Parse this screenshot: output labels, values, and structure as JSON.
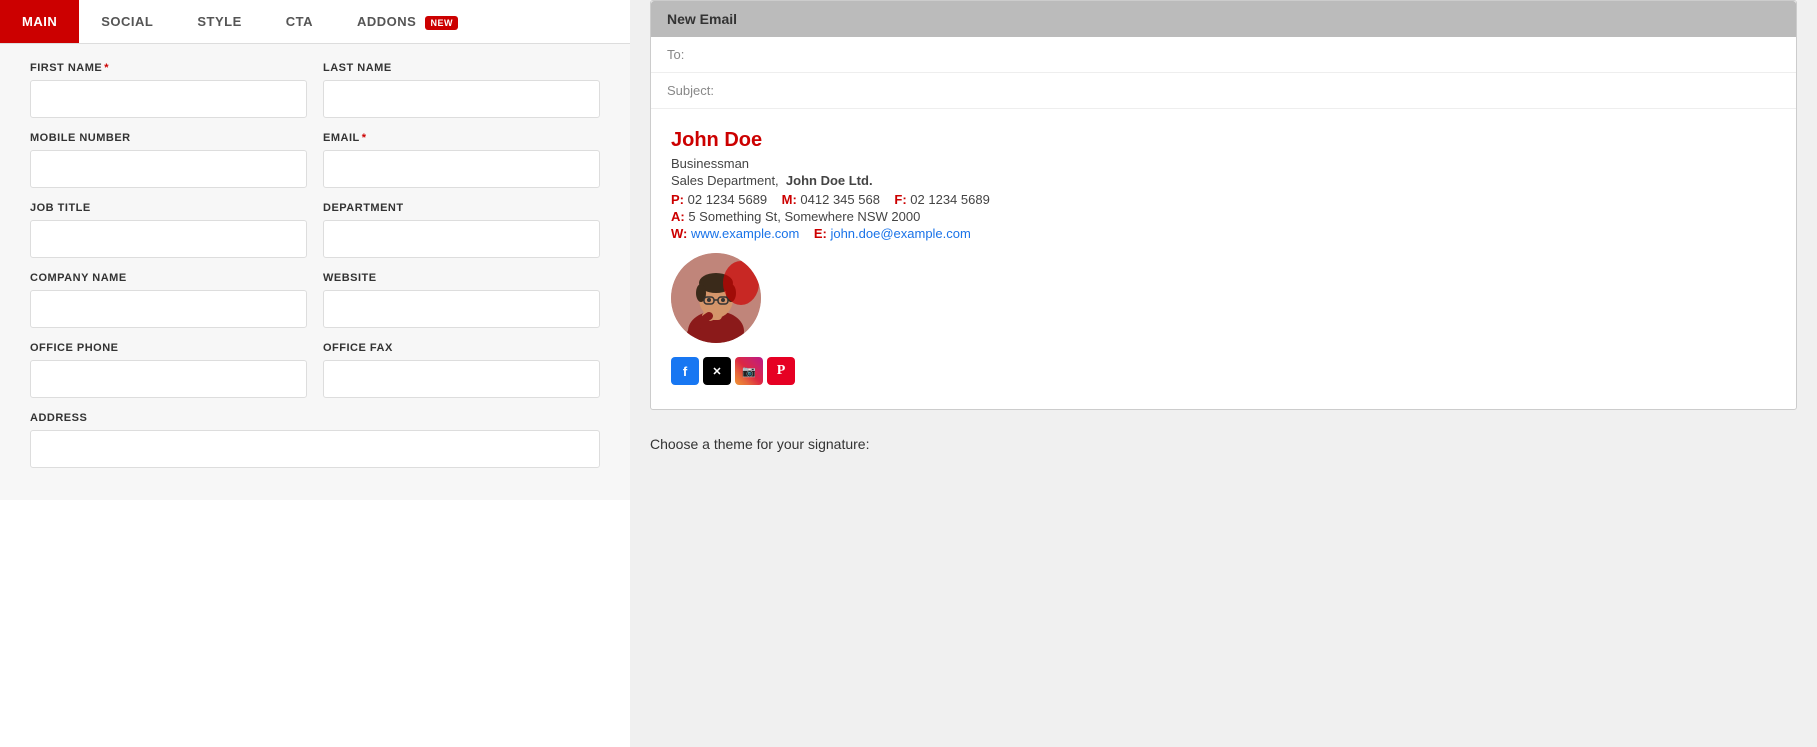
{
  "tabs": [
    {
      "id": "main",
      "label": "MAIN",
      "active": true,
      "badge": null
    },
    {
      "id": "social",
      "label": "SOCIAL",
      "active": false,
      "badge": null
    },
    {
      "id": "style",
      "label": "STYLE",
      "active": false,
      "badge": null
    },
    {
      "id": "cta",
      "label": "CTA",
      "active": false,
      "badge": null
    },
    {
      "id": "addons",
      "label": "ADDONS",
      "active": false,
      "badge": "NEW"
    }
  ],
  "form": {
    "fields": [
      {
        "id": "first-name",
        "label": "FIRST NAME",
        "required": true,
        "value": "",
        "placeholder": ""
      },
      {
        "id": "last-name",
        "label": "LAST NAME",
        "required": false,
        "value": "",
        "placeholder": ""
      },
      {
        "id": "mobile-number",
        "label": "MOBILE NUMBER",
        "required": false,
        "value": "",
        "placeholder": ""
      },
      {
        "id": "email",
        "label": "EMAIL",
        "required": true,
        "value": "",
        "placeholder": ""
      },
      {
        "id": "job-title",
        "label": "JOB TITLE",
        "required": false,
        "value": "",
        "placeholder": ""
      },
      {
        "id": "department",
        "label": "DEPARTMENT",
        "required": false,
        "value": "",
        "placeholder": ""
      },
      {
        "id": "company-name",
        "label": "COMPANY NAME",
        "required": false,
        "value": "",
        "placeholder": ""
      },
      {
        "id": "website",
        "label": "WEBSITE",
        "required": false,
        "value": "",
        "placeholder": ""
      },
      {
        "id": "office-phone",
        "label": "OFFICE PHONE",
        "required": false,
        "value": "",
        "placeholder": ""
      },
      {
        "id": "office-fax",
        "label": "OFFICE FAX",
        "required": false,
        "value": "",
        "placeholder": ""
      }
    ],
    "address": {
      "id": "address",
      "label": "ADDRESS",
      "required": false,
      "value": "",
      "placeholder": ""
    }
  },
  "email_preview": {
    "title": "New Email",
    "to_label": "To:",
    "subject_label": "Subject:"
  },
  "signature": {
    "name": "John Doe",
    "title": "Businessman",
    "dept_prefix": "Sales Department,",
    "company": "John Doe Ltd.",
    "phone_p_label": "P:",
    "phone_p_value": "02 1234 5689",
    "phone_m_label": "M:",
    "phone_m_value": "0412 345 568",
    "phone_f_label": "F:",
    "phone_f_value": "02 1234 5689",
    "address_label": "A:",
    "address_value": "5 Something St,  Somewhere NSW 2000",
    "web_label": "W:",
    "web_value": "www.example.com",
    "email_label": "E:",
    "email_value": "john.doe@example.com"
  },
  "social": [
    {
      "id": "facebook",
      "label": "f",
      "class": "facebook"
    },
    {
      "id": "twitter",
      "label": "𝕏",
      "class": "twitter"
    },
    {
      "id": "instagram",
      "label": "📷",
      "class": "instagram"
    },
    {
      "id": "pinterest",
      "label": "P",
      "class": "pinterest"
    }
  ],
  "theme_section": {
    "label": "Choose a theme for your signature:"
  }
}
